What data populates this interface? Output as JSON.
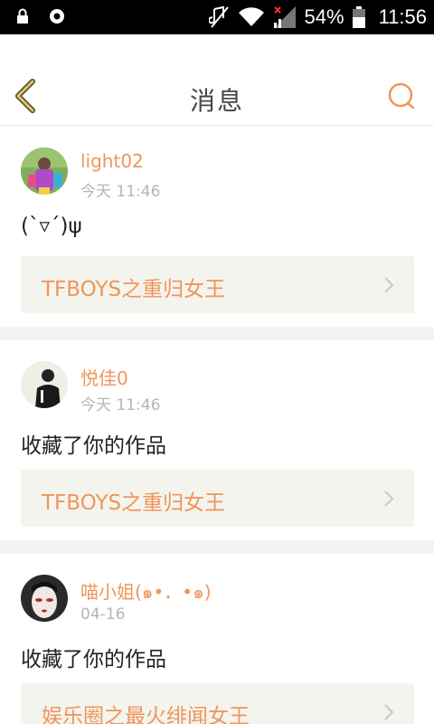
{
  "status_bar": {
    "battery": "54%",
    "time": "11:56",
    "icons": [
      "lock-icon",
      "sync-icon",
      "mute-icon",
      "wifi-icon",
      "signal-icon",
      "battery-icon"
    ]
  },
  "header": {
    "title": "消息",
    "back_icon": "chevron-left-icon",
    "search_icon": "search-icon"
  },
  "colors": {
    "accent": "#f0955a",
    "back_icon": "#e8c64a",
    "link_bg": "#f4f4ee",
    "divider": "#f3f3f3"
  },
  "messages": [
    {
      "username": "light02",
      "time": "今天 11:46",
      "content": "(`▿´)ψ",
      "work_title": "TFBOYS之重归女王"
    },
    {
      "username": "悦佳0",
      "time": "今天 11:46",
      "content": "收藏了你的作品",
      "work_title": "TFBOYS之重归女王"
    },
    {
      "username": "喵小姐(๑•．•๑)",
      "time": "04-16",
      "content": "收藏了你的作品",
      "work_title": "娱乐圈之最火绯闻女王"
    }
  ]
}
